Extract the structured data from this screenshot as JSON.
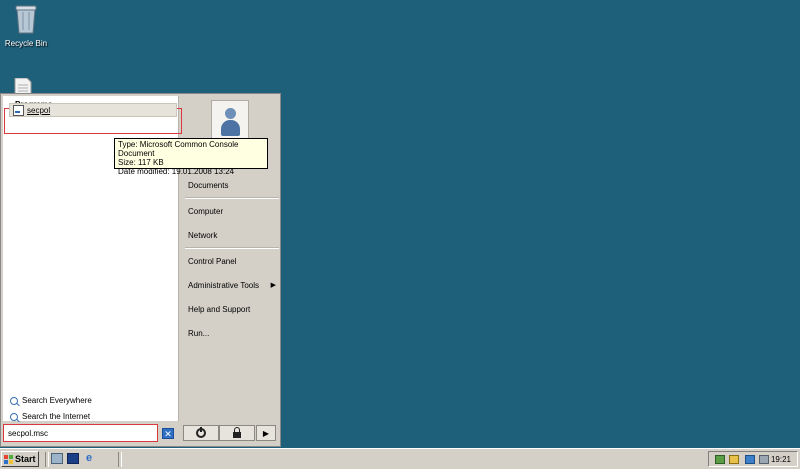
{
  "desktop": {
    "recycle_bin_label": "Recycle Bin"
  },
  "start_menu": {
    "programs_header": "Programs",
    "result_item": "secpol",
    "search_everywhere": "Search Everywhere",
    "search_internet": "Search the Internet",
    "search_value": "secpol.msc",
    "clear_glyph": "✕",
    "right_items": {
      "documents": "Documents",
      "computer": "Computer",
      "network": "Network",
      "control_panel": "Control Panel",
      "admin_tools": "Administrative Tools",
      "help": "Help and Support",
      "run": "Run..."
    },
    "submenu_arrow": "▶",
    "options_arrow": "▶"
  },
  "tooltip": {
    "line1": "Type: Microsoft Common Console Document",
    "line2": "Size: 117 KB",
    "line3": "Date modified: 19.01.2008 13:24"
  },
  "taskbar": {
    "start_label": "Start",
    "ie_glyph": "e",
    "clock": "19:21"
  },
  "colors": {
    "desktop": "#1e5f7a",
    "highlight_box": "#d9383e",
    "tooltip_bg": "#ffffe1"
  },
  "icons": [
    "recycle-bin-icon",
    "document-icon",
    "console-icon",
    "user-picture",
    "search-icon",
    "power-icon",
    "lock-icon",
    "windows-flag-icon",
    "server-manager-icon",
    "powershell-icon",
    "internet-explorer-icon"
  ]
}
